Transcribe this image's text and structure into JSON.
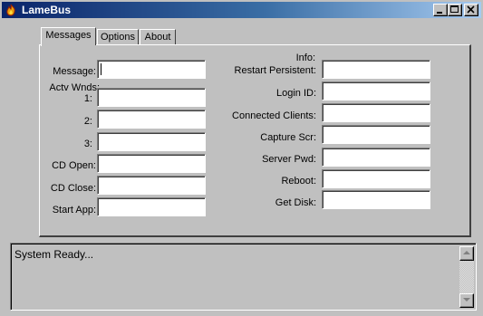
{
  "window": {
    "title": "LameBus",
    "icon": "flame-app-icon",
    "controls": [
      "minimize-icon",
      "maximize-icon",
      "close-icon"
    ]
  },
  "tabs": [
    {
      "label": "Messages",
      "active": true
    },
    {
      "label": "Options",
      "active": false
    },
    {
      "label": "About",
      "active": false
    }
  ],
  "left": {
    "message_label": "Message:",
    "actv_wnds_label": "Actv Wnds:",
    "wnd1_label": "1:",
    "wnd2_label": "2:",
    "wnd3_label": "3:",
    "cd_open_label": "CD Open:",
    "cd_close_label": "CD Close:",
    "start_app_label": "Start App:"
  },
  "right": {
    "info_label": "Info:",
    "restart_label": "Restart Persistent:",
    "login_label": "Login ID:",
    "clients_label": "Connected Clients:",
    "capture_label": "Capture Scr:",
    "server_pwd_label": "Server Pwd:",
    "reboot_label": "Reboot:",
    "get_disk_label": "Get Disk:"
  },
  "status": {
    "text": "System Ready..."
  }
}
